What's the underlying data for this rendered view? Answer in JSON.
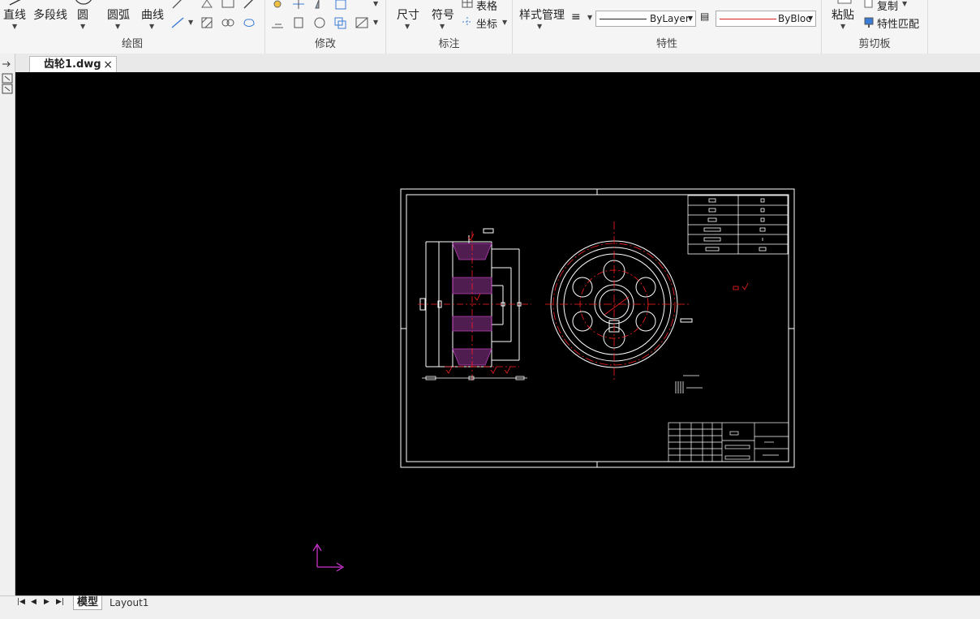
{
  "ribbon": {
    "draw": {
      "label": "绘图",
      "line": "直线",
      "polyline": "多段线",
      "circle": "圆",
      "arc": "圆弧",
      "curve": "曲线"
    },
    "modify": {
      "label": "修改"
    },
    "annotate": {
      "label": "标注",
      "dimension": "尺寸",
      "symbol": "符号",
      "table": "表格",
      "coordinate": "坐标"
    },
    "properties": {
      "label": "特性",
      "style_manager": "样式管理",
      "linetype_value": "ByLayer",
      "lineweight_value": "ByBloc"
    },
    "clipboard": {
      "label": "剪切板",
      "paste": "粘贴",
      "copy": "复制",
      "match": "特性匹配"
    }
  },
  "document": {
    "tab_name": "齿轮1.dwg",
    "close_glyph": "×"
  },
  "layout_tabs": {
    "model": "模型",
    "layout1": "Layout1"
  },
  "colors": {
    "canvas": "#000000",
    "drawing_white": "#ffffff",
    "center_red": "#ff2020",
    "hatch_magenta": "#c040c0",
    "ucs_magenta": "#cc33cc"
  }
}
